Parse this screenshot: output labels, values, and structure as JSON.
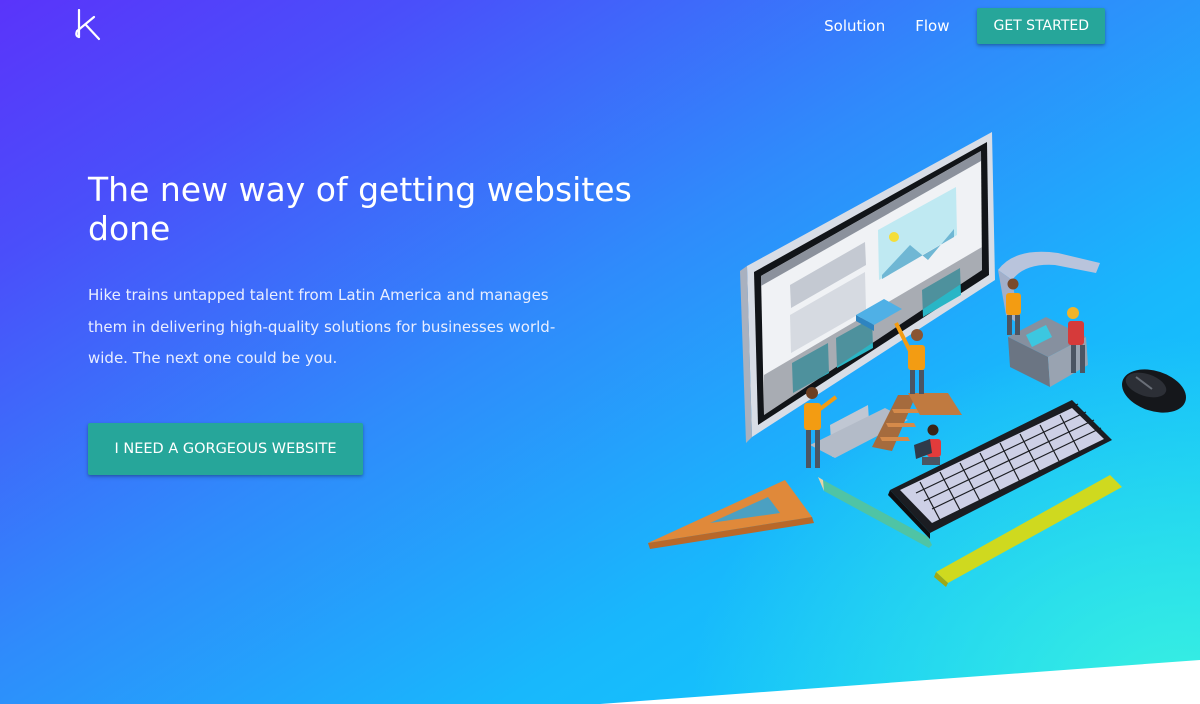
{
  "brand": {
    "logo_icon": "hike-k-logo-icon"
  },
  "nav": {
    "links": [
      "Solution",
      "Flow"
    ],
    "cta_label": "GET STARTED"
  },
  "hero": {
    "headline": "The new way of getting websites done",
    "description": "Hike trains untapped talent from Latin America and manages them in delivering high-quality solutions for businesses world-wide. The next one could be you.",
    "cta_label": "I NEED A GORGEOUS WEBSITE"
  },
  "illustration": {
    "icon": "isometric-web-team-illustration"
  },
  "colors": {
    "gradient_start": "#5a34fa",
    "gradient_end": "#0fd2fb",
    "accent_teal": "#26a69a",
    "text": "#ffffff"
  }
}
